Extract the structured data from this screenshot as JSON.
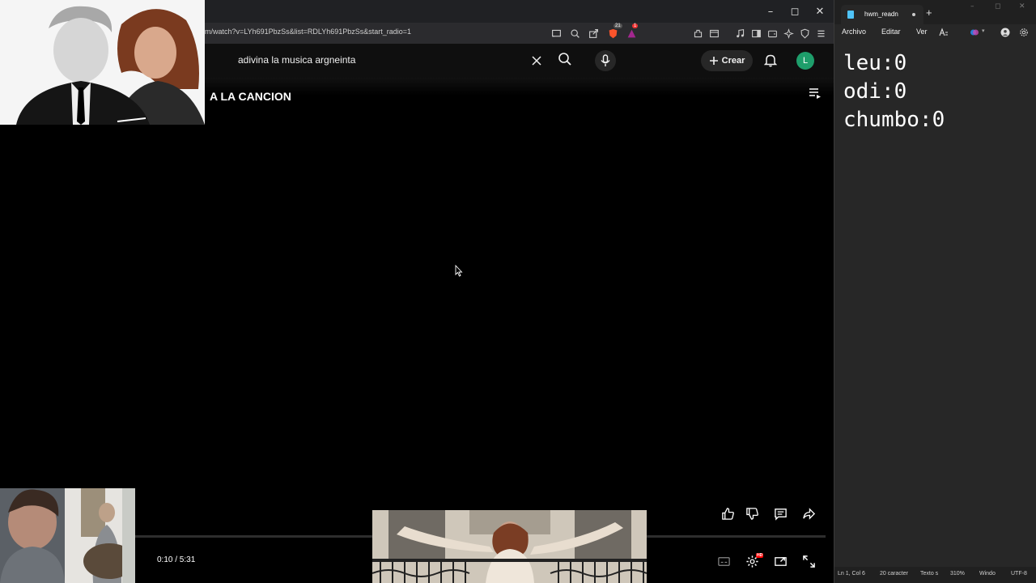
{
  "browser": {
    "url": "m/watch?v=LYh691PbzSs&list=RDLYh691PbzSs&start_radio=1",
    "shields_count": "21",
    "rewards_count": "1"
  },
  "youtube": {
    "search_value": "adivina la musica argneinta",
    "create_label": "Crear",
    "avatar_letter": "L",
    "video_title": "A LA CANCION",
    "progress_fraction": 0.031,
    "time_display": "0:10 / 5:31",
    "hd_badge": "HD",
    "accent_color": "#ff0000"
  },
  "notepad": {
    "tab_title": "hwm_readn",
    "menus": [
      "Archivo",
      "Editar",
      "Ver"
    ],
    "lines": [
      "leu:0",
      "odi:0",
      "chumbo:0"
    ],
    "status": {
      "position": "Ln 1, Col 6",
      "chars": "20 caracter",
      "format": "Texto s",
      "zoom": "310%",
      "line_ending": "Windo",
      "encoding": "UTF-8"
    }
  }
}
